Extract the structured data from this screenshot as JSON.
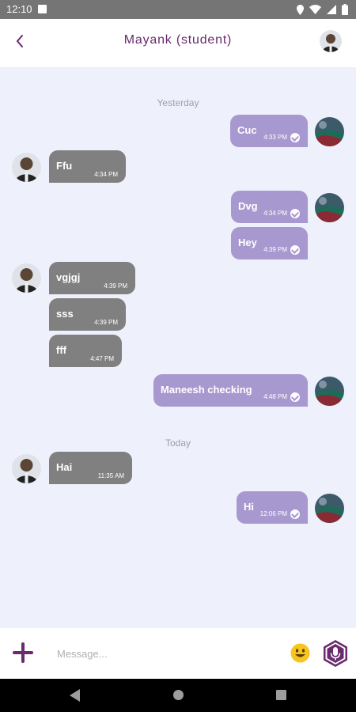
{
  "status": {
    "time": "12:10"
  },
  "header": {
    "title": "Mayank (student)"
  },
  "chat": {
    "dividers": [
      "Yesterday",
      "Today"
    ],
    "messages": [
      {
        "dir": "sent",
        "text": "Cuc",
        "time": "4:33 PM"
      },
      {
        "dir": "recv",
        "text": "Ffu",
        "time": "4:34 PM"
      },
      {
        "dir": "sent",
        "text": "Dvg",
        "time": "4:34 PM"
      },
      {
        "dir": "sent",
        "text": "Hey",
        "time": "4:39 PM"
      },
      {
        "dir": "recv",
        "text": "vgjgj",
        "time": "4:39 PM"
      },
      {
        "dir": "recv",
        "text": "sss",
        "time": "4:39 PM"
      },
      {
        "dir": "recv",
        "text": "fff",
        "time": "4:47 PM"
      },
      {
        "dir": "sent",
        "text": "Maneesh checking",
        "time": "4:48 PM"
      },
      {
        "dir": "recv",
        "text": "Hai",
        "time": "11:35 AM"
      },
      {
        "dir": "sent",
        "text": "Hi",
        "time": "12:06 PM"
      }
    ]
  },
  "composer": {
    "placeholder": "Message..."
  },
  "colors": {
    "accent": "#6a2a6e",
    "sent_bubble": "#a898d0",
    "recv_bubble": "#808080",
    "chat_bg": "#eef0fb"
  }
}
